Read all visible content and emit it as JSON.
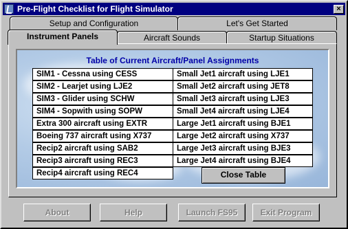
{
  "window": {
    "title": "Pre-Flight Checklist for Flight Simulator",
    "close_glyph": "×"
  },
  "tabs": {
    "back_row": [
      {
        "label": "Setup and Configuration"
      },
      {
        "label": "Let's Get Started"
      }
    ],
    "front_row": [
      {
        "label": "Instrument Panels",
        "selected": true
      },
      {
        "label": "Aircraft Sounds",
        "selected": false
      },
      {
        "label": "Startup Situations",
        "selected": false
      }
    ]
  },
  "panel": {
    "table_title": "Table of Current Aircraft/Panel Assignments",
    "left_column": [
      "SIM1 - Cessna using CESS",
      "SIM2 - Learjet using LJE2",
      "SIM3 - Glider using SCHW",
      "SIM4 - Sopwith using SOPW",
      "Extra 300 aircraft using EXTR",
      "Boeing 737 aircraft using X737",
      "Recip2 aircraft using SAB2",
      "Recip3 aircraft using REC3",
      "Recip4 aircraft using REC4"
    ],
    "right_column": [
      "Small Jet1 aircraft using LJE1",
      "Small Jet2 aircraft using JET8",
      "Small Jet3 aircraft using LJE3",
      "Small Jet4 aircraft using LJE4",
      "Large Jet1 aircraft using BJE1",
      "Large Jet2 aircraft using X737",
      "Large Jet3 aircraft using BJE3",
      "Large Jet4 aircraft using BJE4"
    ],
    "close_table_label": "Close Table"
  },
  "buttons": {
    "about": "About",
    "help": "Help",
    "launch": "Launch FS95",
    "exit": "Exit Program",
    "enabled": false
  },
  "colors": {
    "title_bar": "#000080",
    "table_title": "#0000a8",
    "face": "#c0c0c0",
    "sky": "#b3cbe6"
  }
}
